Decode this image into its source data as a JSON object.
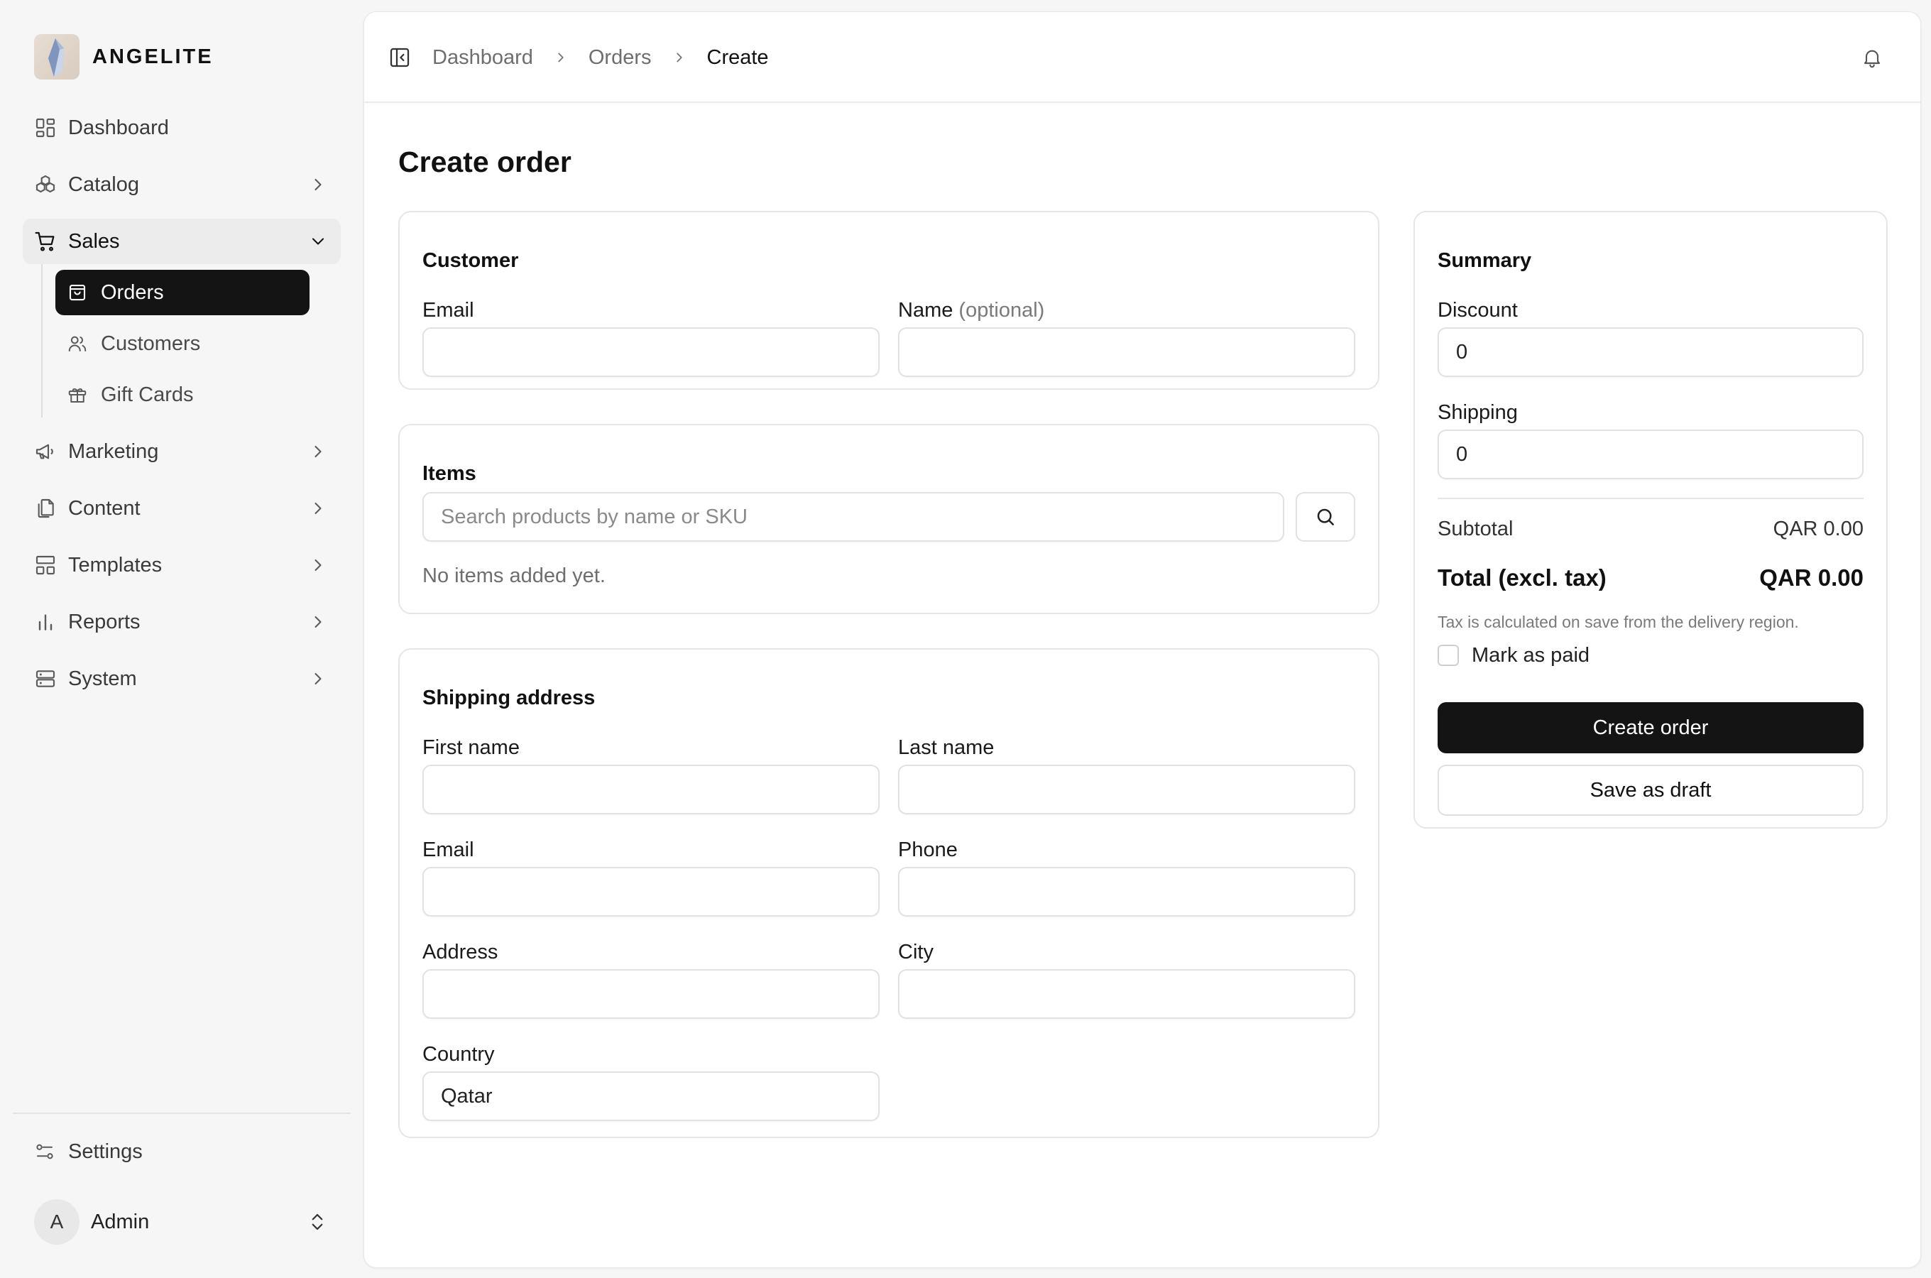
{
  "brand": {
    "name": "ANGELITE"
  },
  "sidebar": {
    "items": [
      {
        "label": "Dashboard"
      },
      {
        "label": "Catalog"
      },
      {
        "label": "Sales"
      },
      {
        "label": "Marketing"
      },
      {
        "label": "Content"
      },
      {
        "label": "Templates"
      },
      {
        "label": "Reports"
      },
      {
        "label": "System"
      }
    ],
    "sales_children": [
      {
        "label": "Orders",
        "active": true
      },
      {
        "label": "Customers"
      },
      {
        "label": "Gift Cards"
      }
    ],
    "settings_label": "Settings",
    "user": {
      "initial": "A",
      "name": "Admin"
    }
  },
  "breadcrumb": [
    "Dashboard",
    "Orders",
    "Create"
  ],
  "page": {
    "title": "Create order"
  },
  "customer": {
    "title": "Customer",
    "email_label": "Email",
    "email_value": "",
    "name_label": "Name",
    "name_optional": "(optional)",
    "name_value": ""
  },
  "items": {
    "title": "Items",
    "search_placeholder": "Search products by name or SKU",
    "empty_text": "No items added yet."
  },
  "shipping_address": {
    "title": "Shipping address",
    "first_name_label": "First name",
    "first_name_value": "",
    "last_name_label": "Last name",
    "last_name_value": "",
    "email_label": "Email",
    "email_value": "",
    "phone_label": "Phone",
    "phone_value": "",
    "address_label": "Address",
    "address_value": "",
    "city_label": "City",
    "city_value": "",
    "country_label": "Country",
    "country_value": "Qatar"
  },
  "summary": {
    "title": "Summary",
    "discount_label": "Discount",
    "discount_value": "0",
    "shipping_label": "Shipping",
    "shipping_value": "0",
    "subtotal_label": "Subtotal",
    "subtotal_value": "QAR 0.00",
    "total_label": "Total (excl. tax)",
    "total_value": "QAR 0.00",
    "tax_note": "Tax is calculated on save from the delivery region.",
    "mark_paid_label": "Mark as paid",
    "create_button": "Create order",
    "draft_button": "Save as draft"
  },
  "colors": {
    "primary": "#141414",
    "background": "#f6f6f6",
    "border": "#e6e6e6"
  }
}
